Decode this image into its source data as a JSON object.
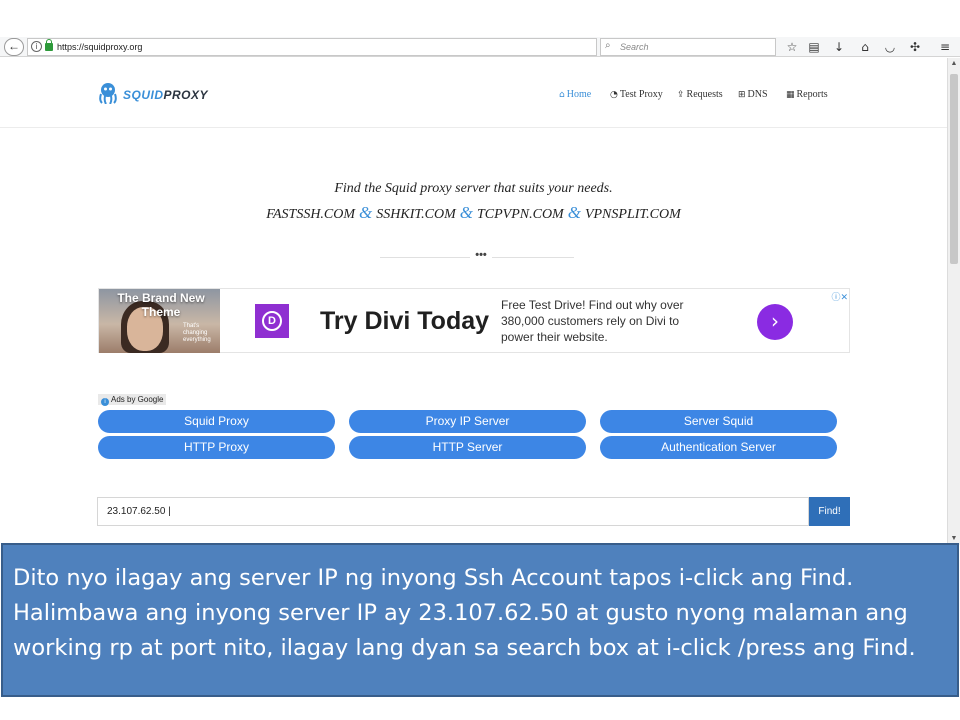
{
  "browser": {
    "back_icon": "back-arrow-icon",
    "url": "https://squidproxy.org",
    "reload_icon": "reload-icon",
    "search_placeholder": "Search",
    "toolbar_icons": [
      "star-icon",
      "reading-list-icon",
      "download-icon",
      "home-icon",
      "pocket-icon",
      "extension-icon",
      "menu-icon"
    ]
  },
  "site": {
    "logo_part_a": "SQUID",
    "logo_part_b": "PROXY",
    "nav": [
      {
        "label": "Home",
        "icon": "home-icon",
        "active": true
      },
      {
        "label": "Test Proxy",
        "icon": "rss-icon",
        "active": false
      },
      {
        "label": "Requests",
        "icon": "share-icon",
        "active": false
      },
      {
        "label": "DNS",
        "icon": "sitemap-icon",
        "active": false
      },
      {
        "label": "Reports",
        "icon": "report-icon",
        "active": false
      }
    ],
    "tagline": "Find the Squid proxy server that suits your needs.",
    "sites": [
      "FASTSSH.COM",
      "SSHKIT.COM",
      "TCPVPN.COM",
      "VPNSPLIT.COM"
    ],
    "amp": "&",
    "divider": "•••"
  },
  "ad": {
    "photo_title": "The Brand New Theme",
    "photo_sub": "That's changing everything",
    "logo_letter": "D",
    "headline": "Try Divi Today",
    "copy": "Free Test Drive! Find out why over 380,000 customers rely on Divi to power their website.",
    "cta_icon": "chevron-right-icon",
    "choices": "ⓘ✕",
    "ads_by": "Ads by Google"
  },
  "link_buttons": [
    "Squid Proxy",
    "Proxy IP Server",
    "Server Squid",
    "HTTP Proxy",
    "HTTP Server",
    "Authentication Server"
  ],
  "search": {
    "value": "23.107.62.50 |",
    "button": "Find!"
  },
  "caption": {
    "lines": [
      "Dito nyo ilagay ang server IP ng inyong Ssh Account tapos i-click ang Find.",
      "Halimbawa ang inyong server IP ay  23.107.62.50 at gusto nyong malaman ang",
      "working rp at port nito, ilagay lang dyan sa search box at i-click /press ang Find."
    ]
  },
  "colors": {
    "accent": "#3d86e5",
    "find_button": "#2f6fb8",
    "caption_bg": "#4f81bd",
    "ad_purple": "#8a2be2"
  }
}
